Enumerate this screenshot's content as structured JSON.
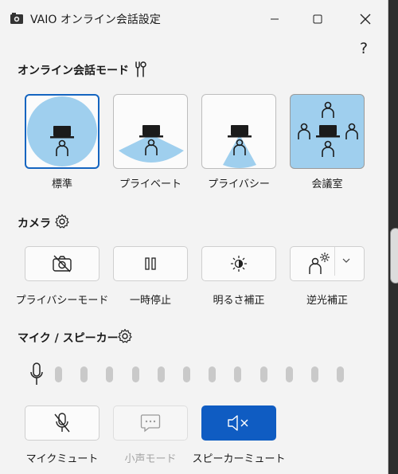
{
  "window": {
    "title": "VAIO オンライン会話設定",
    "help_label": "?"
  },
  "colors": {
    "accent": "#1565c0",
    "primary_button": "#0f5cc2",
    "beam_fill": "#9fcfee"
  },
  "mode_section": {
    "title": "オンライン会話モード",
    "icon": "tools-icon",
    "selected": "標準",
    "modes": [
      {
        "label": "標準",
        "icon": "standard-mode-icon"
      },
      {
        "label": "プライベート",
        "icon": "private-mode-icon"
      },
      {
        "label": "プライバシー",
        "icon": "privacy-mode-icon"
      },
      {
        "label": "会議室",
        "icon": "meeting-room-mode-icon"
      }
    ]
  },
  "camera_section": {
    "title": "カメラ",
    "icon": "gear-icon",
    "buttons": [
      {
        "label": "プライバシーモード",
        "icon": "camera-off-icon"
      },
      {
        "label": "一時停止",
        "icon": "pause-icon"
      },
      {
        "label": "明るさ補正",
        "icon": "brightness-icon"
      },
      {
        "label": "逆光補正",
        "icon": "backlight-icon"
      }
    ]
  },
  "audio_section": {
    "title": "マイク / スピーカー",
    "icon": "gear-icon",
    "mic_level": 0,
    "meter_segments": 12,
    "buttons": [
      {
        "label": "マイクミュート",
        "icon": "mic-mute-icon",
        "state": "normal"
      },
      {
        "label": "小声モード",
        "icon": "whisper-icon",
        "state": "disabled"
      },
      {
        "label": "スピーカーミュート",
        "icon": "speaker-mute-icon",
        "state": "active"
      }
    ]
  }
}
